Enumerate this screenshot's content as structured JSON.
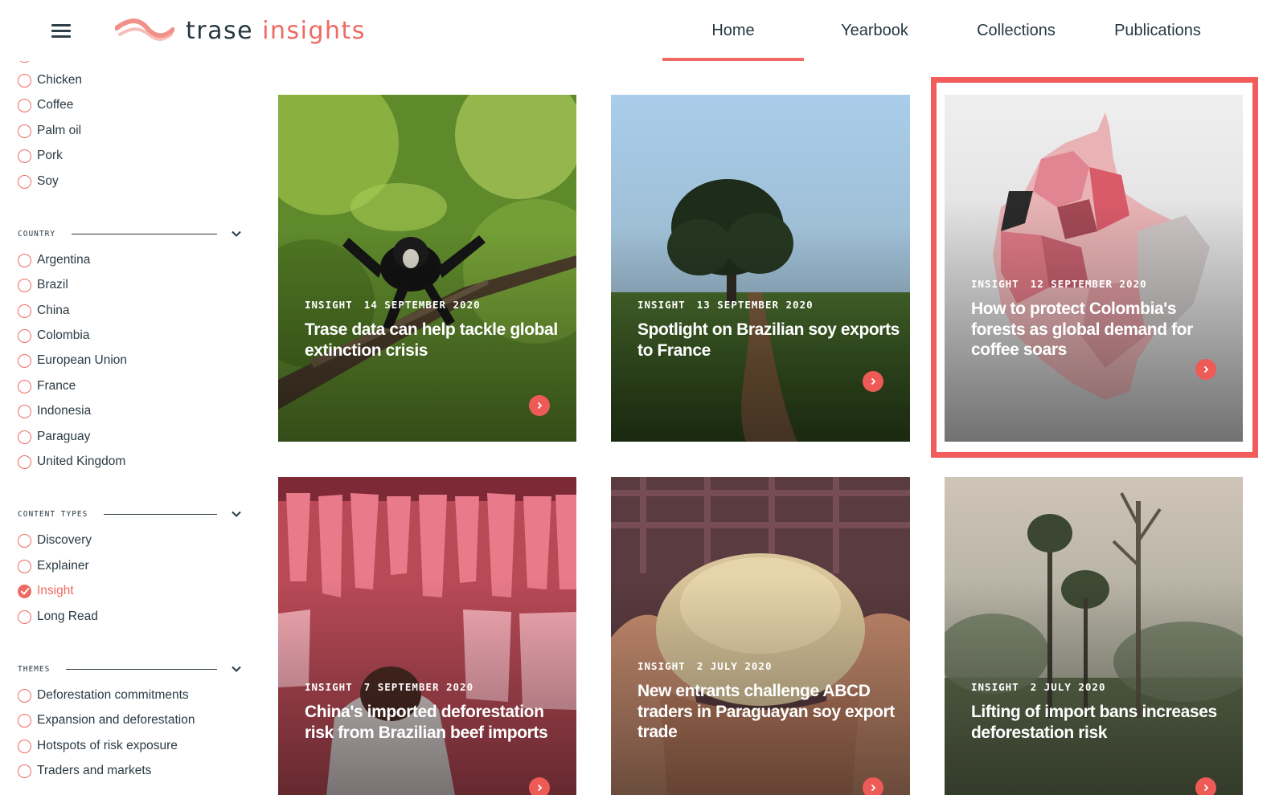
{
  "header": {
    "logo": {
      "word1": "trase",
      "word2": "insights"
    },
    "nav": [
      {
        "label": "Home",
        "active": true
      },
      {
        "label": "Yearbook",
        "active": false
      },
      {
        "label": "Collections",
        "active": false
      },
      {
        "label": "Publications",
        "active": false
      }
    ]
  },
  "sidebar": {
    "commodities": [
      "Chicken",
      "Coffee",
      "Palm oil",
      "Pork",
      "Soy"
    ],
    "country": {
      "title": "COUNTRY",
      "items": [
        "Argentina",
        "Brazil",
        "China",
        "Colombia",
        "European Union",
        "France",
        "Indonesia",
        "Paraguay",
        "United Kingdom"
      ]
    },
    "content_types": {
      "title": "CONTENT TYPES",
      "items": [
        "Discovery",
        "Explainer",
        "Insight",
        "Long Read"
      ],
      "checked": "Insight"
    },
    "themes": {
      "title": "THEMES",
      "items": [
        "Deforestation commitments",
        "Expansion and deforestation",
        "Hotspots of risk exposure",
        "Traders and markets"
      ]
    }
  },
  "cards": [
    {
      "type": "INSIGHT",
      "date": "14 SEPTEMBER 2020",
      "title": "Trase data can help tackle global extinction crisis",
      "image": "monkey-in-tree"
    },
    {
      "type": "INSIGHT",
      "date": "13 SEPTEMBER 2020",
      "title": "Spotlight on Brazilian soy exports to France",
      "image": "tree-in-soy-field"
    },
    {
      "type": "INSIGHT",
      "date": "12 SEPTEMBER 2020",
      "title": "How to protect Colombia's forests as global demand for coffee soars",
      "image": "colombia-map",
      "highlighted": true
    },
    {
      "type": "INSIGHT",
      "date": "7 SEPTEMBER 2020",
      "title": "China's imported deforestation risk from Brazilian beef imports",
      "image": "meat-market"
    },
    {
      "type": "INSIGHT",
      "date": "2 JULY 2020",
      "title": "New entrants challenge ABCD traders in Paraguayan soy export trade",
      "image": "soybeans-in-hands"
    },
    {
      "type": "INSIGHT",
      "date": "2 JULY 2020",
      "title": "Lifting of import bans increases deforestation risk",
      "image": "smoky-cleared-forest"
    }
  ],
  "colors": {
    "accent": "#ee6a62",
    "highlight": "#f25c5c",
    "text": "#2b3a44"
  }
}
